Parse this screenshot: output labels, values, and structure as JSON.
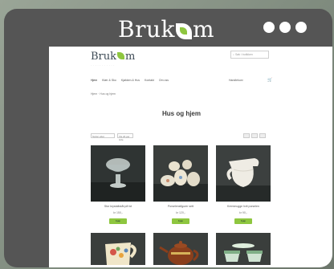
{
  "app": {
    "title_left": "Bruk",
    "title_right": "m"
  },
  "site": {
    "logo_left": "Bruk",
    "logo_right": "m",
    "logo_sub": "· · · · · · · · · · ·",
    "search_placeholder": "Søk i butikken",
    "nav": [
      "Hjem",
      "Klær & Sko",
      "Kjøkken & Hus",
      "Kontakt",
      "Om oss"
    ],
    "cart_label": "Handlekurv",
    "breadcrumb": "Hjem · Hus og hjem",
    "page_title": "Hus og hjem",
    "sort_label": "Sorter etter",
    "show_label": "Vis 24 per side",
    "products": [
      {
        "name": "Stor krystallskål på fot",
        "price": "kr 150,-",
        "button": "Kjøp",
        "image": "crystal-bowl"
      },
      {
        "name": "Porselensfigurer sett",
        "price": "kr 120,-",
        "button": "Kjøp",
        "image": "porcelain-set"
      },
      {
        "name": "Kremmugge hvit porselen",
        "price": "kr 90,-",
        "button": "Kjøp",
        "image": "white-jug"
      },
      {
        "name": "Mugge med blomster",
        "price": "kr 80,-",
        "button": "Kjøp",
        "image": "floral-jug"
      },
      {
        "name": "Brun tekanne",
        "price": "kr 110,-",
        "button": "Kjøp",
        "image": "brown-teapot"
      },
      {
        "name": "Grønne kopper",
        "price": "kr 70,-",
        "button": "Kjøp",
        "image": "green-cups"
      }
    ]
  }
}
